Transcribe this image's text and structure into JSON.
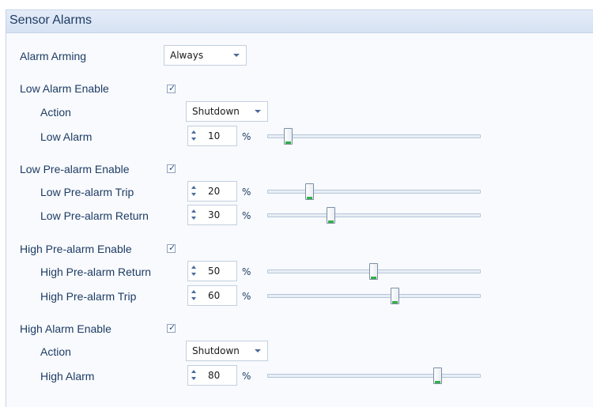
{
  "header": {
    "title": "Sensor Alarms"
  },
  "alarm_arming": {
    "label": "Alarm Arming",
    "value": "Always"
  },
  "low_alarm": {
    "enable_label": "Low Alarm Enable",
    "enabled": true,
    "action_label": "Action",
    "action_value": "Shutdown",
    "level_label": "Low Alarm",
    "level_value": "10",
    "unit": "%",
    "level_percent": 10
  },
  "low_prealarm": {
    "enable_label": "Low Pre-alarm Enable",
    "enabled": true,
    "trip_label": "Low Pre-alarm Trip",
    "trip_value": "20",
    "trip_percent": 20,
    "return_label": "Low Pre-alarm Return",
    "return_value": "30",
    "return_percent": 30,
    "unit": "%"
  },
  "high_prealarm": {
    "enable_label": "High Pre-alarm Enable",
    "enabled": true,
    "return_label": "High Pre-alarm Return",
    "return_value": "50",
    "return_percent": 50,
    "trip_label": "High Pre-alarm Trip",
    "trip_value": "60",
    "trip_percent": 60,
    "unit": "%"
  },
  "high_alarm": {
    "enable_label": "High Alarm Enable",
    "enabled": true,
    "action_label": "Action",
    "action_value": "Shutdown",
    "level_label": "High Alarm",
    "level_value": "80",
    "unit": "%",
    "level_percent": 80
  },
  "icons": {
    "checkbox": "checkmark-icon",
    "dropdown": "chevron-down-icon",
    "spinner": "spinner-arrows-icon",
    "slider_thumb": "slider-thumb-icon"
  },
  "colors": {
    "label_text": "#1e3c64",
    "header_bg": "#dae4f3",
    "thumb_grip": "#34b04a",
    "panel_border": "#c5d3e6"
  }
}
